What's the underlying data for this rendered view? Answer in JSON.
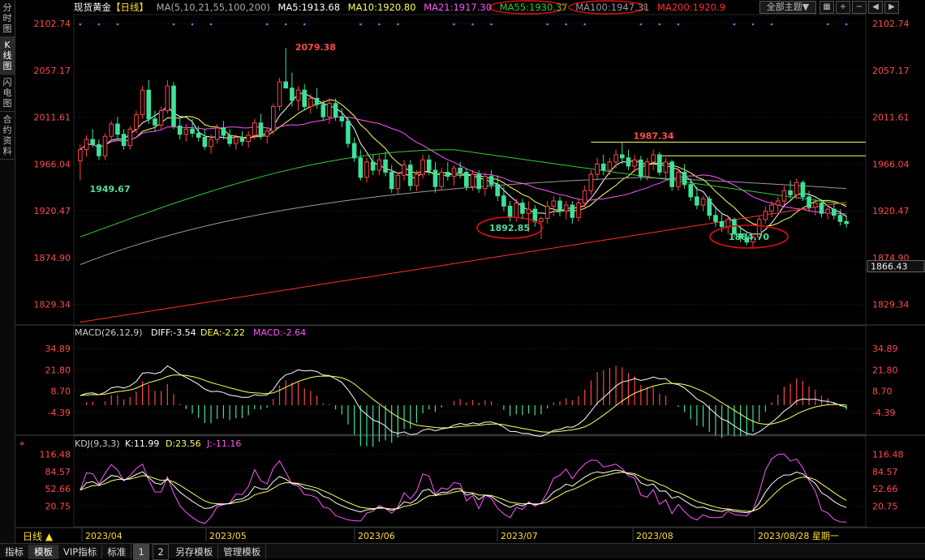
{
  "sidebar": {
    "items": [
      "分时图",
      "K线图",
      "闪电图",
      "合约资料"
    ],
    "active_index": 1
  },
  "topbar": {
    "instrument": "现货黄金",
    "period": "【日线】",
    "ma_params": "MA(5,10,21,55,100,200)",
    "ma5": "MA5:1913.68",
    "ma10": "MA10:1920.80",
    "ma21": "MA21:1917.30",
    "ma55": "MA55:1930.37",
    "ma100": "MA100:1947.31",
    "ma200": "MA200:1920.9",
    "theme_label": "全部主题▼"
  },
  "price_axis": {
    "ticks": [
      "2102.74",
      "2057.17",
      "2011.61",
      "1966.04",
      "1920.47",
      "1874.90",
      "1829.34"
    ],
    "tick_values": [
      2102.74,
      2057.17,
      2011.61,
      1966.04,
      1920.47,
      1874.9,
      1829.34
    ],
    "current_price": "1866.43"
  },
  "macd": {
    "title": "MACD(26,12,9)",
    "diff": "DIFF:-3.54",
    "dea": "DEA:-2.22",
    "macd": "MACD:-2.64",
    "ticks": [
      "34.89",
      "21.80",
      "8.70",
      "-4.39"
    ]
  },
  "kdj": {
    "title": "KDJ(9,3,3)",
    "k": "K:11.99",
    "d": "D:23.56",
    "j": "J:-11.16",
    "ticks": [
      "116.48",
      "84.57",
      "52.66",
      "20.75"
    ]
  },
  "time_axis": [
    "2023/04",
    "2023/05",
    "2023/06",
    "2023/07",
    "2023/08",
    "2023/08/28 星期一"
  ],
  "period_button": "日线 ▲",
  "bottom_tabs": [
    "指标",
    "模板",
    "VIP指标",
    "标准",
    "1",
    "2",
    "另存模板",
    "管理模板"
  ],
  "annotations": {
    "high_may": "2079.38",
    "low_apr": "1949.67",
    "low_jun": "1892.85",
    "high_jul": "1987.34",
    "low_aug": "1884.70"
  },
  "colors": {
    "up": "#ff4545",
    "down": "#3ee09a",
    "ma5": "#ffffff",
    "ma10": "#ffff66",
    "ma21": "#ff55ff",
    "ma55": "#33cc33",
    "ma100": "#999999",
    "ma200": "#ff3030",
    "label_red": "#ff4b4b",
    "label_green": "#55dd99",
    "ellipse": "#e01010"
  },
  "chart_data": {
    "type": "candlestick",
    "instrument": "现货黄金",
    "period": "日线",
    "x_labels": [
      "2023/04",
      "2023/05",
      "2023/06",
      "2023/07",
      "2023/08",
      "2023/08/28 星期一"
    ],
    "ylim": [
      1810,
      2110
    ],
    "ohlc": [
      [
        1969,
        1985,
        1950,
        1980
      ],
      [
        1980,
        1994,
        1973,
        1990
      ],
      [
        1990,
        2000,
        1982,
        1985
      ],
      [
        1985,
        1990,
        1970,
        1974
      ],
      [
        1974,
        1996,
        1970,
        1993
      ],
      [
        1993,
        2008,
        1989,
        2005
      ],
      [
        2005,
        2012,
        1990,
        1995
      ],
      [
        1995,
        2000,
        1980,
        1984
      ],
      [
        1984,
        2003,
        1980,
        2000
      ],
      [
        2000,
        2018,
        1996,
        2014
      ],
      [
        2014,
        2042,
        2010,
        2038
      ],
      [
        2038,
        2048,
        2005,
        2010
      ],
      [
        2010,
        2018,
        1998,
        2004
      ],
      [
        2004,
        2022,
        2000,
        2018
      ],
      [
        2018,
        2048,
        2015,
        2042
      ],
      [
        2042,
        2046,
        2000,
        2003
      ],
      [
        2003,
        2012,
        1990,
        1995
      ],
      [
        1995,
        2005,
        1988,
        2000
      ],
      [
        2000,
        2010,
        1992,
        1996
      ],
      [
        1996,
        2003,
        1988,
        1992
      ],
      [
        1992,
        2000,
        1980,
        1983
      ],
      [
        1983,
        1995,
        1976,
        1990
      ],
      [
        1990,
        2005,
        1986,
        2001
      ],
      [
        2001,
        2008,
        1990,
        1994
      ],
      [
        1994,
        2000,
        1983,
        1986
      ],
      [
        1986,
        1995,
        1980,
        1992
      ],
      [
        1992,
        1998,
        1984,
        1988
      ],
      [
        1988,
        1998,
        1982,
        1994
      ],
      [
        1994,
        2010,
        1990,
        2006
      ],
      [
        2006,
        2015,
        1990,
        1993
      ],
      [
        1993,
        2002,
        1986,
        1998
      ],
      [
        1998,
        2025,
        1995,
        2022
      ],
      [
        2022,
        2050,
        2018,
        2046
      ],
      [
        2046,
        2079,
        2040,
        2040
      ],
      [
        2040,
        2055,
        2022,
        2028
      ],
      [
        2028,
        2042,
        2018,
        2038
      ],
      [
        2038,
        2044,
        2018,
        2022
      ],
      [
        2022,
        2034,
        2015,
        2030
      ],
      [
        2030,
        2040,
        2020,
        2024
      ],
      [
        2024,
        2028,
        2008,
        2012
      ],
      [
        2012,
        2030,
        2005,
        2025
      ],
      [
        2025,
        2030,
        2008,
        2012
      ],
      [
        2012,
        2020,
        2002,
        2008
      ],
      [
        2008,
        2012,
        1982,
        1986
      ],
      [
        1986,
        1992,
        1968,
        1972
      ],
      [
        1972,
        1980,
        1950,
        1953
      ],
      [
        1953,
        1972,
        1948,
        1968
      ],
      [
        1968,
        1975,
        1955,
        1960
      ],
      [
        1960,
        1975,
        1955,
        1970
      ],
      [
        1970,
        1978,
        1954,
        1958
      ],
      [
        1958,
        1965,
        1938,
        1942
      ],
      [
        1942,
        1958,
        1936,
        1955
      ],
      [
        1955,
        1970,
        1950,
        1965
      ],
      [
        1965,
        1970,
        1940,
        1945
      ],
      [
        1945,
        1960,
        1940,
        1956
      ],
      [
        1956,
        1975,
        1952,
        1970
      ],
      [
        1970,
        1975,
        1955,
        1960
      ],
      [
        1960,
        1968,
        1938,
        1944
      ],
      [
        1944,
        1962,
        1940,
        1958
      ],
      [
        1958,
        1968,
        1950,
        1954
      ],
      [
        1954,
        1965,
        1945,
        1962
      ],
      [
        1962,
        1968,
        1952,
        1958
      ],
      [
        1958,
        1962,
        1940,
        1944
      ],
      [
        1944,
        1960,
        1940,
        1956
      ],
      [
        1956,
        1960,
        1938,
        1942
      ],
      [
        1942,
        1958,
        1935,
        1954
      ],
      [
        1954,
        1960,
        1942,
        1946
      ],
      [
        1946,
        1955,
        1930,
        1935
      ],
      [
        1935,
        1944,
        1920,
        1925
      ],
      [
        1925,
        1930,
        1910,
        1914
      ],
      [
        1914,
        1932,
        1910,
        1928
      ],
      [
        1928,
        1932,
        1912,
        1918
      ],
      [
        1918,
        1930,
        1900,
        1922
      ],
      [
        1922,
        1926,
        1905,
        1910
      ],
      [
        1910,
        1915,
        1893,
        1913
      ],
      [
        1913,
        1930,
        1908,
        1925
      ],
      [
        1925,
        1935,
        1915,
        1930
      ],
      [
        1930,
        1934,
        1915,
        1920
      ],
      [
        1920,
        1930,
        1912,
        1926
      ],
      [
        1926,
        1930,
        1908,
        1914
      ],
      [
        1914,
        1932,
        1910,
        1928
      ],
      [
        1928,
        1945,
        1924,
        1940
      ],
      [
        1940,
        1960,
        1936,
        1956
      ],
      [
        1956,
        1972,
        1950,
        1966
      ],
      [
        1966,
        1975,
        1955,
        1960
      ],
      [
        1960,
        1972,
        1955,
        1968
      ],
      [
        1968,
        1980,
        1962,
        1975
      ],
      [
        1975,
        1987,
        1966,
        1972
      ],
      [
        1972,
        1980,
        1960,
        1964
      ],
      [
        1964,
        1975,
        1958,
        1970
      ],
      [
        1970,
        1974,
        1950,
        1954
      ],
      [
        1954,
        1972,
        1950,
        1968
      ],
      [
        1968,
        1980,
        1960,
        1975
      ],
      [
        1975,
        1978,
        1955,
        1958
      ],
      [
        1958,
        1972,
        1952,
        1968
      ],
      [
        1968,
        1970,
        1940,
        1944
      ],
      [
        1944,
        1962,
        1940,
        1958
      ],
      [
        1958,
        1966,
        1942,
        1946
      ],
      [
        1946,
        1952,
        1930,
        1934
      ],
      [
        1934,
        1944,
        1922,
        1926
      ],
      [
        1926,
        1935,
        1920,
        1932
      ],
      [
        1932,
        1935,
        1912,
        1916
      ],
      [
        1916,
        1925,
        1905,
        1910
      ],
      [
        1910,
        1918,
        1900,
        1905
      ],
      [
        1905,
        1915,
        1898,
        1912
      ],
      [
        1912,
        1914,
        1895,
        1898
      ],
      [
        1898,
        1906,
        1890,
        1894
      ],
      [
        1894,
        1900,
        1887,
        1890
      ],
      [
        1890,
        1898,
        1885,
        1895
      ],
      [
        1895,
        1915,
        1892,
        1912
      ],
      [
        1912,
        1925,
        1908,
        1920
      ],
      [
        1920,
        1930,
        1914,
        1926
      ],
      [
        1926,
        1934,
        1920,
        1930
      ],
      [
        1930,
        1945,
        1926,
        1940
      ],
      [
        1940,
        1950,
        1932,
        1936
      ],
      [
        1936,
        1952,
        1932,
        1948
      ],
      [
        1948,
        1950,
        1930,
        1934
      ],
      [
        1934,
        1940,
        1920,
        1924
      ],
      [
        1924,
        1932,
        1916,
        1928
      ],
      [
        1928,
        1932,
        1914,
        1918
      ],
      [
        1918,
        1926,
        1912,
        1922
      ],
      [
        1922,
        1928,
        1912,
        1916
      ],
      [
        1916,
        1922,
        1906,
        1910
      ],
      [
        1910,
        1916,
        1904,
        1908
      ]
    ],
    "price_lines": [
      {
        "name": "1987.34",
        "y": 1987.34,
        "color": "#ffff66"
      },
      {
        "name": "",
        "y": 1974,
        "color": "#ffff66"
      }
    ],
    "panels": [
      {
        "name": "MACD(26,12,9)",
        "ylim": [
          -15,
          40
        ]
      },
      {
        "name": "KDJ(9,3,3)",
        "ylim": [
          -15,
          125
        ]
      }
    ]
  }
}
